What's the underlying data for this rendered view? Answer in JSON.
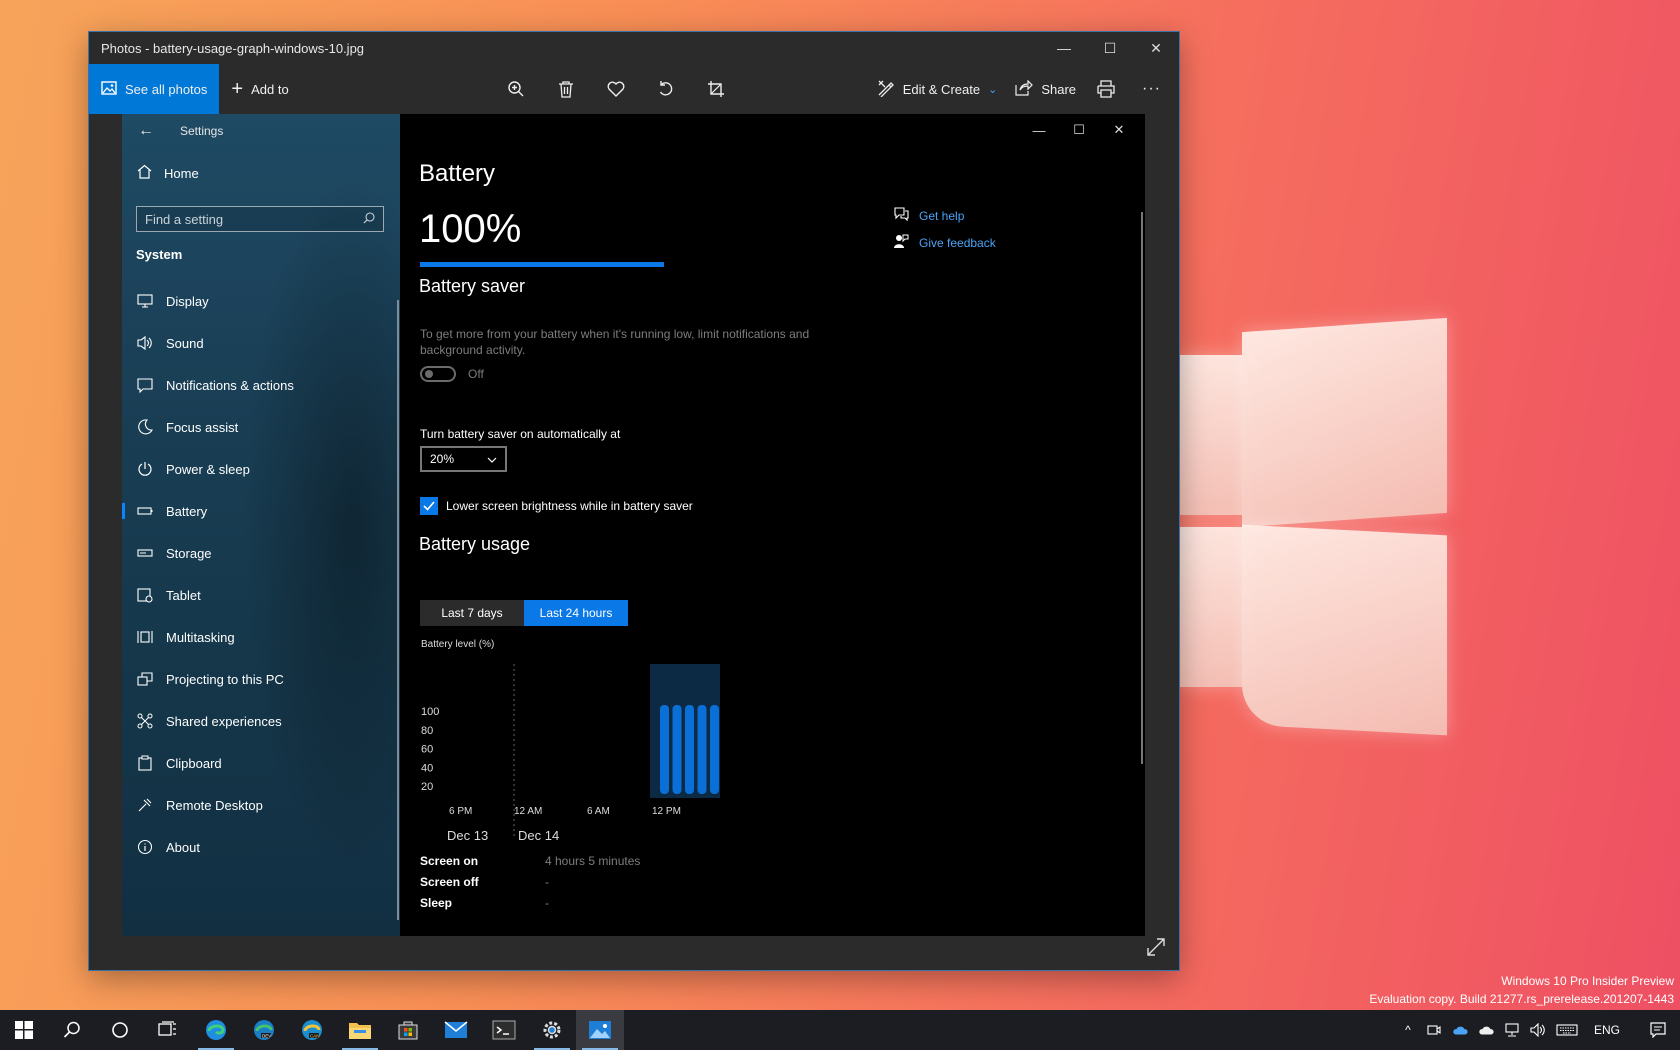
{
  "window": {
    "title": "Photos - battery-usage-graph-windows-10.jpg",
    "controls": {
      "minimize": "—",
      "maximize": "☐",
      "close": "✕"
    }
  },
  "toolbar": {
    "see_all_label": "See all photos",
    "add_to_label": "Add to",
    "edit_create_label": "Edit & Create",
    "share_label": "Share",
    "more_label": "···"
  },
  "settings": {
    "header": "Settings",
    "home_label": "Home",
    "search_placeholder": "Find a setting",
    "section_label": "System",
    "nav_items": [
      {
        "label": "Display",
        "icon": "monitor-icon"
      },
      {
        "label": "Sound",
        "icon": "speaker-icon"
      },
      {
        "label": "Notifications & actions",
        "icon": "notification-icon"
      },
      {
        "label": "Focus assist",
        "icon": "moon-icon"
      },
      {
        "label": "Power & sleep",
        "icon": "power-icon"
      },
      {
        "label": "Battery",
        "icon": "battery-icon"
      },
      {
        "label": "Storage",
        "icon": "storage-icon"
      },
      {
        "label": "Tablet",
        "icon": "tablet-icon"
      },
      {
        "label": "Multitasking",
        "icon": "multitasking-icon"
      },
      {
        "label": "Projecting to this PC",
        "icon": "projecting-icon"
      },
      {
        "label": "Shared experiences",
        "icon": "shared-icon"
      },
      {
        "label": "Clipboard",
        "icon": "clipboard-icon"
      },
      {
        "label": "Remote Desktop",
        "icon": "remote-desktop-icon"
      },
      {
        "label": "About",
        "icon": "info-icon"
      }
    ],
    "selected_index": 5
  },
  "battery": {
    "title": "Battery",
    "percent_label": "100%",
    "level_fraction": 1.0,
    "saver_title": "Battery saver",
    "saver_desc": "To get more from your battery when it's running low, limit notifications and background activity.",
    "saver_state": "Off",
    "auto_label": "Turn battery saver on automatically at",
    "auto_value": "20%",
    "brightness_label": "Lower screen brightness while in battery saver",
    "brightness_checked": true,
    "usage_title": "Battery usage",
    "tab_7days": "Last 7 days",
    "tab_24h": "Last 24 hours",
    "active_tab": "Last 24 hours",
    "help_label": "Get help",
    "feedback_label": "Give feedback",
    "stats": [
      {
        "key": "Screen on",
        "value": "4 hours 5 minutes"
      },
      {
        "key": "Screen off",
        "value": "-"
      },
      {
        "key": "Sleep",
        "value": "-"
      }
    ]
  },
  "chart_data": {
    "type": "bar",
    "ylabel": "Battery level (%)",
    "yticks": [
      100,
      80,
      60,
      40,
      20
    ],
    "ylim": [
      0,
      100
    ],
    "xticks": [
      "6 PM",
      "12 AM",
      "6 AM",
      "12 PM"
    ],
    "date_labels": [
      "Dec 13",
      "Dec 14"
    ],
    "values": [
      100,
      100,
      100,
      100,
      100
    ],
    "bar_color": "#0a6fd6",
    "highlight_color": "#0d2a45"
  },
  "desktop": {
    "watermark_line1": "Windows 10 Pro Insider Preview",
    "watermark_line2": "Evaluation copy. Build 21277.rs_prerelease.201207-1443"
  },
  "taskbar": {
    "items": [
      "start",
      "search",
      "cortana",
      "task-view",
      "edge",
      "edge-dev",
      "edge-canary",
      "file-explorer",
      "store",
      "mail",
      "terminal",
      "settings",
      "photos"
    ],
    "language": "ENG"
  },
  "colors": {
    "accent": "#0078d7",
    "link": "#4aa3f5"
  }
}
